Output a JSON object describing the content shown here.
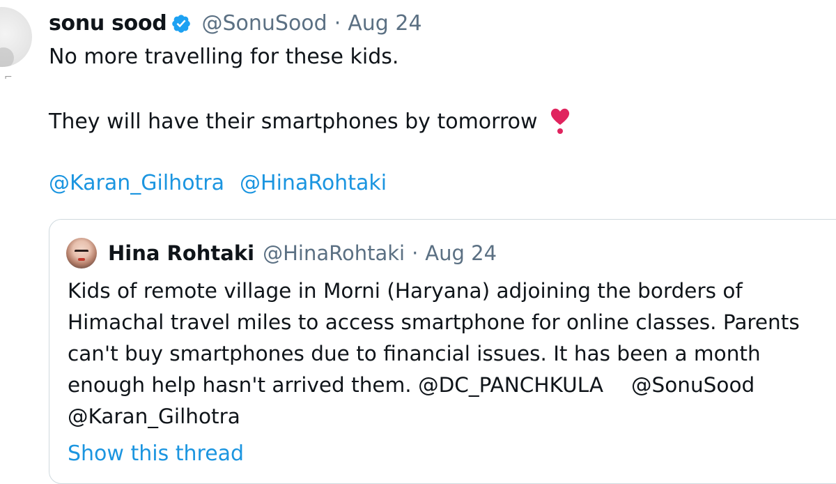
{
  "tweet": {
    "author_name": "sonu sood",
    "author_handle": "@SonuSood",
    "separator": "·",
    "date": "Aug 24",
    "line1": "No more travelling for these kids.",
    "line2": "They will have their smartphones by tomorrow",
    "mention1": "@Karan_Gilhotra",
    "mention2": "@HinaRohtaki",
    "verified_icon": "verified-badge-icon",
    "emoji": "heart-exclamation-emoji",
    "colors": {
      "link": "#1b95e0",
      "muted": "#5b7083",
      "text": "#0f1419",
      "verified": "#1da1f2",
      "heart": "#e0245e"
    }
  },
  "quoted_tweet": {
    "author_name": "Hina Rohtaki",
    "author_handle": "@HinaRohtaki",
    "separator": "·",
    "date": "Aug 24",
    "body_lines": [
      "Kids of remote village in Morni (Haryana) adjoining the borders of",
      "Himachal travel miles to access smartphone for online classes. Parents",
      "can't buy smartphones due to financial issues. It has been a month",
      "enough help hasn't arrived them."
    ],
    "mention_dc": "@DC_PANCHKULA",
    "mention_sonu": "@SonuSood",
    "mention_karan": "@Karan_Gilhotra",
    "show_thread": "Show this thread"
  }
}
